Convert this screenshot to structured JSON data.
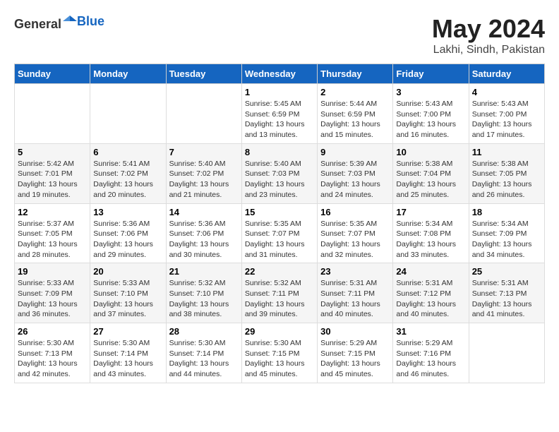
{
  "header": {
    "logo_general": "General",
    "logo_blue": "Blue",
    "month_year": "May 2024",
    "location": "Lakhi, Sindh, Pakistan"
  },
  "days_of_week": [
    "Sunday",
    "Monday",
    "Tuesday",
    "Wednesday",
    "Thursday",
    "Friday",
    "Saturday"
  ],
  "weeks": [
    [
      {
        "day": "",
        "info": ""
      },
      {
        "day": "",
        "info": ""
      },
      {
        "day": "",
        "info": ""
      },
      {
        "day": "1",
        "info": "Sunrise: 5:45 AM\nSunset: 6:59 PM\nDaylight: 13 hours and 13 minutes."
      },
      {
        "day": "2",
        "info": "Sunrise: 5:44 AM\nSunset: 6:59 PM\nDaylight: 13 hours and 15 minutes."
      },
      {
        "day": "3",
        "info": "Sunrise: 5:43 AM\nSunset: 7:00 PM\nDaylight: 13 hours and 16 minutes."
      },
      {
        "day": "4",
        "info": "Sunrise: 5:43 AM\nSunset: 7:00 PM\nDaylight: 13 hours and 17 minutes."
      }
    ],
    [
      {
        "day": "5",
        "info": "Sunrise: 5:42 AM\nSunset: 7:01 PM\nDaylight: 13 hours and 19 minutes."
      },
      {
        "day": "6",
        "info": "Sunrise: 5:41 AM\nSunset: 7:02 PM\nDaylight: 13 hours and 20 minutes."
      },
      {
        "day": "7",
        "info": "Sunrise: 5:40 AM\nSunset: 7:02 PM\nDaylight: 13 hours and 21 minutes."
      },
      {
        "day": "8",
        "info": "Sunrise: 5:40 AM\nSunset: 7:03 PM\nDaylight: 13 hours and 23 minutes."
      },
      {
        "day": "9",
        "info": "Sunrise: 5:39 AM\nSunset: 7:03 PM\nDaylight: 13 hours and 24 minutes."
      },
      {
        "day": "10",
        "info": "Sunrise: 5:38 AM\nSunset: 7:04 PM\nDaylight: 13 hours and 25 minutes."
      },
      {
        "day": "11",
        "info": "Sunrise: 5:38 AM\nSunset: 7:05 PM\nDaylight: 13 hours and 26 minutes."
      }
    ],
    [
      {
        "day": "12",
        "info": "Sunrise: 5:37 AM\nSunset: 7:05 PM\nDaylight: 13 hours and 28 minutes."
      },
      {
        "day": "13",
        "info": "Sunrise: 5:36 AM\nSunset: 7:06 PM\nDaylight: 13 hours and 29 minutes."
      },
      {
        "day": "14",
        "info": "Sunrise: 5:36 AM\nSunset: 7:06 PM\nDaylight: 13 hours and 30 minutes."
      },
      {
        "day": "15",
        "info": "Sunrise: 5:35 AM\nSunset: 7:07 PM\nDaylight: 13 hours and 31 minutes."
      },
      {
        "day": "16",
        "info": "Sunrise: 5:35 AM\nSunset: 7:07 PM\nDaylight: 13 hours and 32 minutes."
      },
      {
        "day": "17",
        "info": "Sunrise: 5:34 AM\nSunset: 7:08 PM\nDaylight: 13 hours and 33 minutes."
      },
      {
        "day": "18",
        "info": "Sunrise: 5:34 AM\nSunset: 7:09 PM\nDaylight: 13 hours and 34 minutes."
      }
    ],
    [
      {
        "day": "19",
        "info": "Sunrise: 5:33 AM\nSunset: 7:09 PM\nDaylight: 13 hours and 36 minutes."
      },
      {
        "day": "20",
        "info": "Sunrise: 5:33 AM\nSunset: 7:10 PM\nDaylight: 13 hours and 37 minutes."
      },
      {
        "day": "21",
        "info": "Sunrise: 5:32 AM\nSunset: 7:10 PM\nDaylight: 13 hours and 38 minutes."
      },
      {
        "day": "22",
        "info": "Sunrise: 5:32 AM\nSunset: 7:11 PM\nDaylight: 13 hours and 39 minutes."
      },
      {
        "day": "23",
        "info": "Sunrise: 5:31 AM\nSunset: 7:11 PM\nDaylight: 13 hours and 40 minutes."
      },
      {
        "day": "24",
        "info": "Sunrise: 5:31 AM\nSunset: 7:12 PM\nDaylight: 13 hours and 40 minutes."
      },
      {
        "day": "25",
        "info": "Sunrise: 5:31 AM\nSunset: 7:13 PM\nDaylight: 13 hours and 41 minutes."
      }
    ],
    [
      {
        "day": "26",
        "info": "Sunrise: 5:30 AM\nSunset: 7:13 PM\nDaylight: 13 hours and 42 minutes."
      },
      {
        "day": "27",
        "info": "Sunrise: 5:30 AM\nSunset: 7:14 PM\nDaylight: 13 hours and 43 minutes."
      },
      {
        "day": "28",
        "info": "Sunrise: 5:30 AM\nSunset: 7:14 PM\nDaylight: 13 hours and 44 minutes."
      },
      {
        "day": "29",
        "info": "Sunrise: 5:30 AM\nSunset: 7:15 PM\nDaylight: 13 hours and 45 minutes."
      },
      {
        "day": "30",
        "info": "Sunrise: 5:29 AM\nSunset: 7:15 PM\nDaylight: 13 hours and 45 minutes."
      },
      {
        "day": "31",
        "info": "Sunrise: 5:29 AM\nSunset: 7:16 PM\nDaylight: 13 hours and 46 minutes."
      },
      {
        "day": "",
        "info": ""
      }
    ]
  ]
}
